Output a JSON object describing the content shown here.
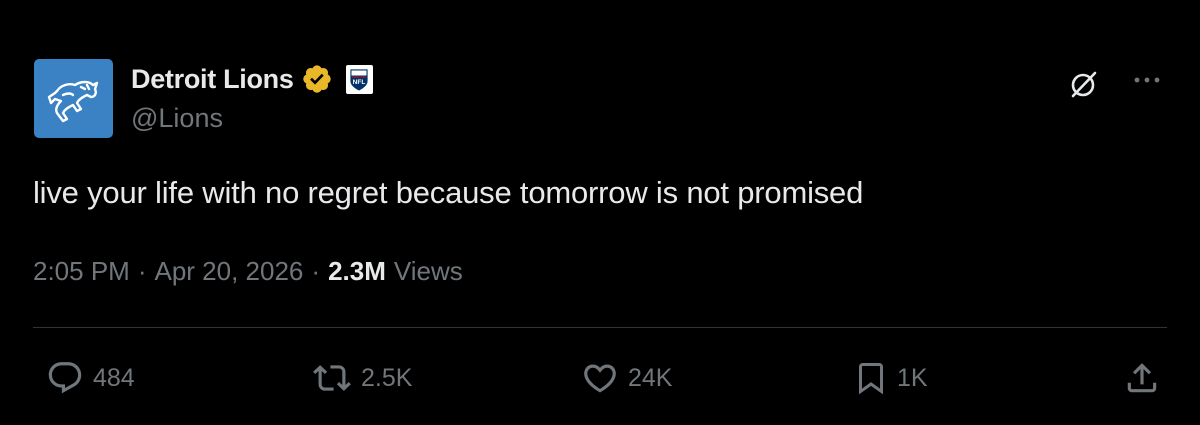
{
  "colors": {
    "background": "#000000",
    "primary_text": "#e7e9ea",
    "secondary_text": "#71767b",
    "divider": "#2f3336",
    "avatar_bg": "#3b82c4",
    "verified_gold": "#e8b829"
  },
  "author": {
    "display_name": "Detroit Lions",
    "handle": "@Lions",
    "verified_badge": "gold-verified-icon",
    "affiliate_badge": "nfl-logo",
    "avatar": "lions-logo"
  },
  "header_actions": {
    "grok_icon": "grok-icon",
    "more_icon": "more-icon"
  },
  "tweet": {
    "text": "live your life with no regret because tomorrow is not promised",
    "time": "2:05 PM",
    "date": "Apr 20, 2026",
    "separator": "·",
    "views_count": "2.3M",
    "views_label": "Views"
  },
  "actions": {
    "reply_count": "484",
    "retweet_count": "2.5K",
    "like_count": "24K",
    "bookmark_count": "1K",
    "share_icon": "share-icon"
  }
}
